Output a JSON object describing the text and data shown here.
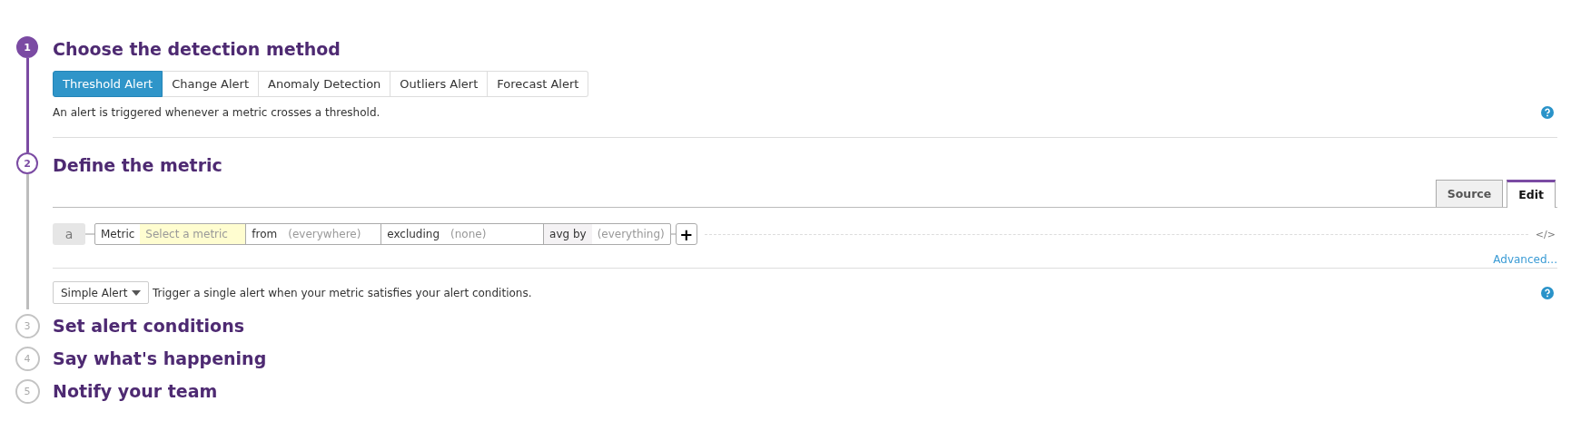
{
  "steps": [
    {
      "number": "1",
      "title": "Choose the detection method",
      "kind": "method",
      "completed": true,
      "current": false
    },
    {
      "number": "2",
      "title": "Define the metric",
      "kind": "metric",
      "completed": false,
      "current": true
    },
    {
      "number": "3",
      "title": "Set alert conditions",
      "kind": "collapsed",
      "completed": false,
      "current": false
    },
    {
      "number": "4",
      "title": "Say what's happening",
      "kind": "collapsed",
      "completed": false,
      "current": false
    },
    {
      "number": "5",
      "title": "Notify your team",
      "kind": "collapsed",
      "completed": false,
      "current": false
    }
  ],
  "method_tabs": [
    {
      "label": "Threshold Alert",
      "selected": true
    },
    {
      "label": "Change Alert",
      "selected": false
    },
    {
      "label": "Anomaly Detection",
      "selected": false
    },
    {
      "label": "Outliers Alert",
      "selected": false
    },
    {
      "label": "Forecast Alert",
      "selected": false
    }
  ],
  "method_description": "An alert is triggered whenever a metric crosses a threshold.",
  "editor_tabs": [
    {
      "label": "Source",
      "selected": false
    },
    {
      "label": "Edit",
      "selected": true
    }
  ],
  "query": {
    "letter": "a",
    "metric_label": "Metric",
    "metric_placeholder": "Select a metric",
    "from_label": "from",
    "from_placeholder": "(everywhere)",
    "excluding_label": "excluding",
    "excluding_placeholder": "(none)",
    "avg_label": "avg by",
    "avg_placeholder": "(everything)",
    "add": "+",
    "code_toggle": "</>"
  },
  "advanced_link": "Advanced...",
  "alert_type": {
    "value": "Simple Alert",
    "description": "Trigger a single alert when your metric satisfies your alert conditions."
  }
}
